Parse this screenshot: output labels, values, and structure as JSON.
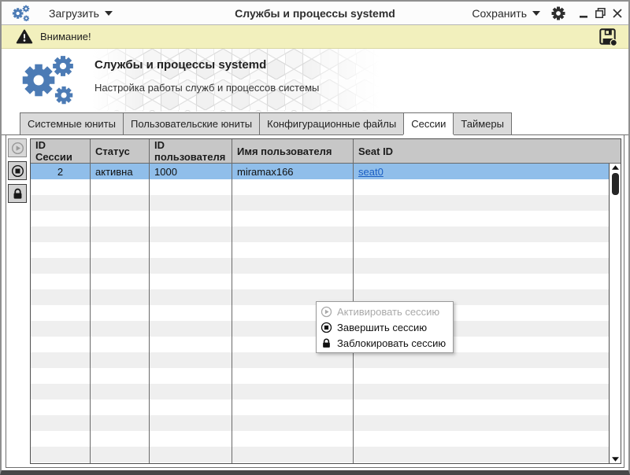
{
  "window": {
    "title": "Службы и процессы systemd",
    "load_label": "Загрузить",
    "save_label": "Сохранить"
  },
  "warning_bar": {
    "text": "Внимание!"
  },
  "banner": {
    "title": "Службы и процессы systemd",
    "subtitle": "Настройка работы служб и процессов системы"
  },
  "tabs": [
    {
      "label": "Системные юниты",
      "active": false
    },
    {
      "label": "Пользовательские юниты",
      "active": false
    },
    {
      "label": "Конфигурационные файлы",
      "active": false
    },
    {
      "label": "Сессии",
      "active": true
    },
    {
      "label": "Таймеры",
      "active": false
    }
  ],
  "toolbar": [
    {
      "icon": "play-circle",
      "enabled": false
    },
    {
      "icon": "stop-circle",
      "enabled": true
    },
    {
      "icon": "lock",
      "enabled": true
    }
  ],
  "table": {
    "columns": [
      "ID Сессии",
      "Статус",
      "ID пользователя",
      "Имя пользователя",
      "Seat ID"
    ],
    "rows": [
      {
        "session_id": "2",
        "status": "активна",
        "user_id": "1000",
        "user_name": "miramax166",
        "seat_id": "seat0",
        "selected": true
      }
    ],
    "empty_row_count": 19
  },
  "context_menu": {
    "items": [
      {
        "label": "Активировать сессию",
        "icon": "play-circle",
        "enabled": false
      },
      {
        "label": "Завершить сессию",
        "icon": "stop-circle",
        "enabled": true
      },
      {
        "label": "Заблокировать сессию",
        "icon": "lock",
        "enabled": true
      }
    ]
  },
  "colors": {
    "accent_blue": "#4C7BB5",
    "warning_bg": "#F2F0BD",
    "selection_bg": "#90BEEA",
    "header_bg": "#C7C7C7",
    "link": "#1B5FC4"
  }
}
